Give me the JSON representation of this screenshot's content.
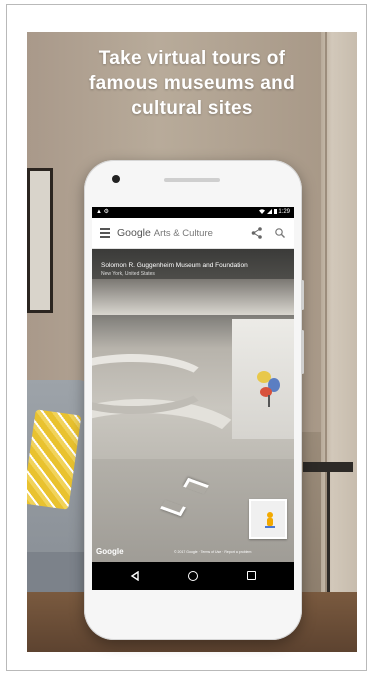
{
  "promo": {
    "headline_line1": "Take virtual tours of",
    "headline_line2": "famous museums and",
    "headline_line3": "cultural sites"
  },
  "status_bar": {
    "left_icons": "▲ ⚙",
    "time": "1:29"
  },
  "app_bar": {
    "brand": "Google",
    "product": "Arts & Culture",
    "icons": [
      "menu-icon",
      "share-icon",
      "search-icon"
    ]
  },
  "tour": {
    "title": "Solomon R. Guggenheim Museum and Foundation",
    "subtitle": "New York, United States",
    "logo": "Google",
    "copyright": "© 2017 Google · Terms of Use · Report a problem"
  },
  "navigation": {
    "icons": [
      "back-icon",
      "home-icon",
      "recents-icon"
    ]
  },
  "colors": {
    "status_bar": "#000000",
    "app_bar": "#ffffff",
    "headline_text": "#ffffff"
  }
}
